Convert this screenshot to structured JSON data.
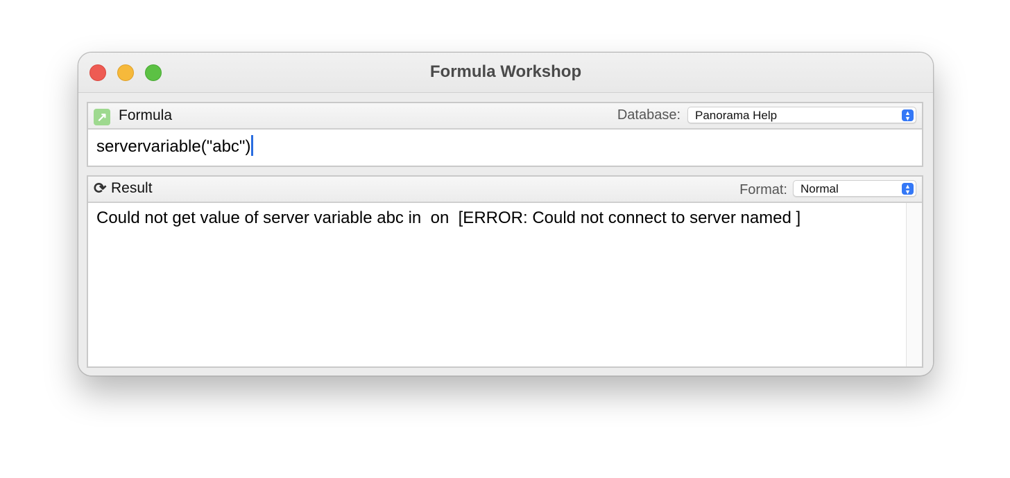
{
  "window": {
    "title": "Formula Workshop"
  },
  "formula_panel": {
    "label": "Formula",
    "database_label": "Database:",
    "database_value": "Panorama Help",
    "formula_text": "servervariable(\"abc\")"
  },
  "result_panel": {
    "label": "Result",
    "format_label": "Format:",
    "format_value": "Normal",
    "result_text": "Could not get value of server variable abc in  on  [ERROR: Could not connect to server named ]"
  },
  "icons": {
    "formula": "arrow-up-right-icon",
    "result": "refresh-icon",
    "popup": "chevron-updown-icon"
  },
  "colors": {
    "accent": "#3478f6",
    "close": "#ee5b53",
    "minimize": "#f6b93b",
    "zoom": "#5cc144",
    "formula_icon": "#9ed98f"
  }
}
